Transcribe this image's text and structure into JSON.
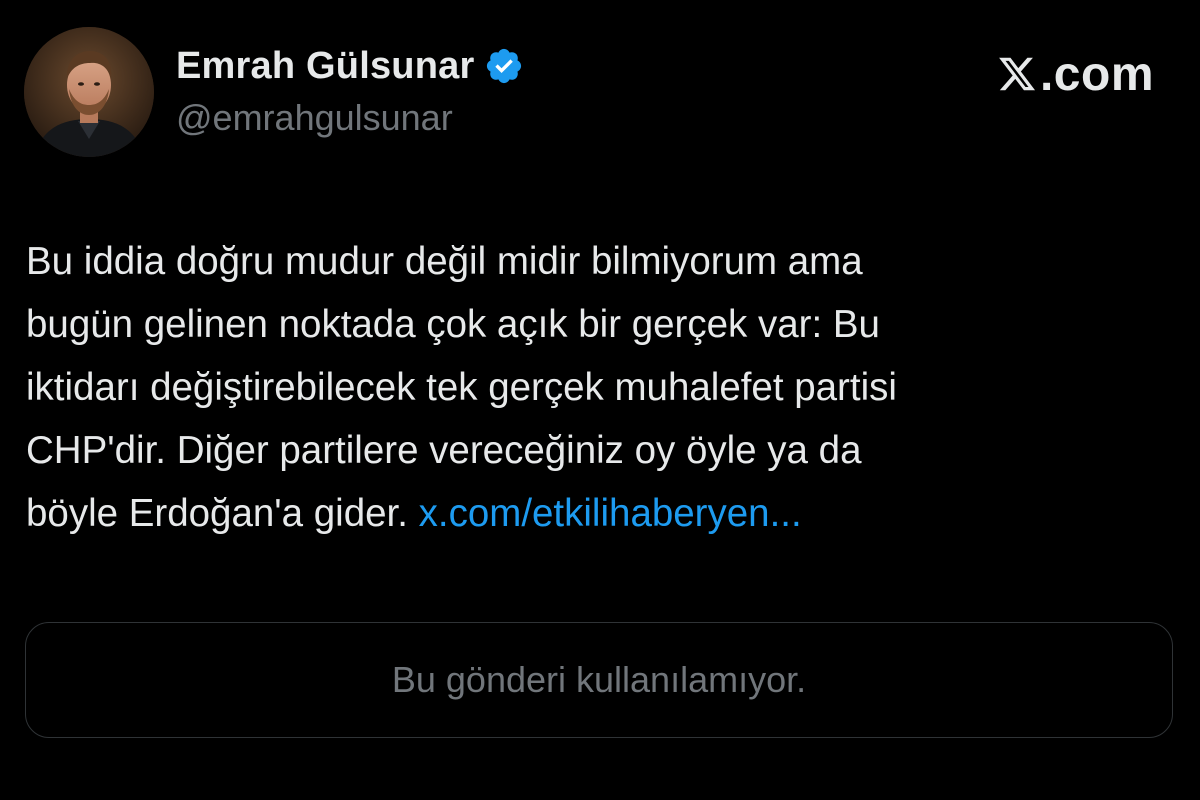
{
  "brand": {
    "suffix": ".com",
    "icon": "x-logo-icon"
  },
  "author": {
    "display_name": "Emrah Gülsunar",
    "handle": "@emrahgulsunar",
    "verified": true,
    "verified_icon": "verified-badge-icon",
    "verified_color": "#1d9bf0"
  },
  "tweet": {
    "lines": [
      "Bu iddia doğru mudur değil midir bilmiyorum ama",
      "bugün gelinen noktada çok açık bir gerçek var: Bu",
      "iktidarı değiştirebilecek tek gerçek muhalefet partisi",
      "CHP'dir. Diğer partilere vereceğiniz oy öyle ya da",
      "böyle Erdoğan'a gider."
    ],
    "link_text": "x.com/etkilihaberyen...",
    "link_color": "#1d9bf0"
  },
  "quote": {
    "unavailable_text": "Bu gönderi kullanılamıyor."
  },
  "colors": {
    "background": "#000000",
    "text_primary": "#e7e9ea",
    "text_secondary": "#71767b",
    "border": "#2f3336"
  }
}
